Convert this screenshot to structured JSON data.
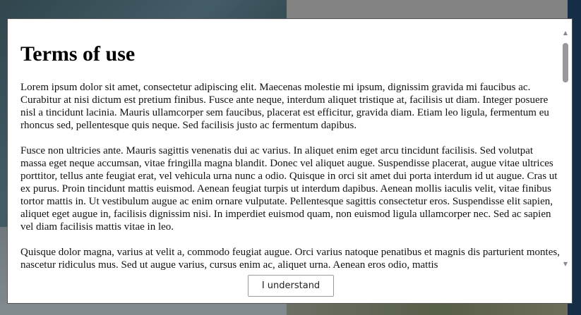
{
  "dialog": {
    "title": "Terms of use",
    "paragraphs": [
      "Lorem ipsum dolor sit amet, consectetur adipiscing elit. Maecenas molestie mi ipsum, dignissim gravida mi faucibus ac. Curabitur at nisi dictum est pretium finibus. Fusce ante neque, interdum aliquet tristique at, facilisis ut diam. Integer posuere nisl a tincidunt lacinia. Mauris ullamcorper sem faucibus, placerat est efficitur, gravida diam. Etiam leo ligula, fermentum eu rhoncus sed, pellentesque quis neque. Sed facilisis justo ac fermentum dapibus.",
      "Fusce non ultricies ante. Mauris sagittis venenatis dui ac varius. In aliquet enim eget arcu tincidunt facilisis. Sed volutpat massa eget neque accumsan, vitae fringilla magna blandit. Donec vel aliquet augue. Suspendisse placerat, augue vitae ultrices porttitor, tellus ante feugiat erat, vel vehicula urna nunc a odio. Quisque in orci sit amet dui porta interdum id ut augue. Cras ut ex purus. Proin tincidunt mattis euismod. Aenean feugiat turpis ut interdum dapibus. Aenean mollis iaculis velit, vitae finibus tortor mattis in. Ut vestibulum augue ac enim ornare vulputate. Pellentesque sagittis consectetur eros. Suspendisse elit sapien, aliquet eget augue in, facilisis dignissim nisi. In imperdiet euismod quam, non euismod ligula ullamcorper nec. Sed ac sapien vel diam facilisis mattis vitae in leo.",
      "Quisque dolor magna, varius at velit a, commodo feugiat augue. Orci varius natoque penatibus et magnis dis parturient montes, nascetur ridiculus mus. Sed ut augue varius, cursus enim ac, aliquet urna. Aenean eros odio, mattis"
    ],
    "button_label": "I understand",
    "scroll_up_icon": "triangle-up-icon",
    "scroll_down_icon": "triangle-down-icon"
  }
}
